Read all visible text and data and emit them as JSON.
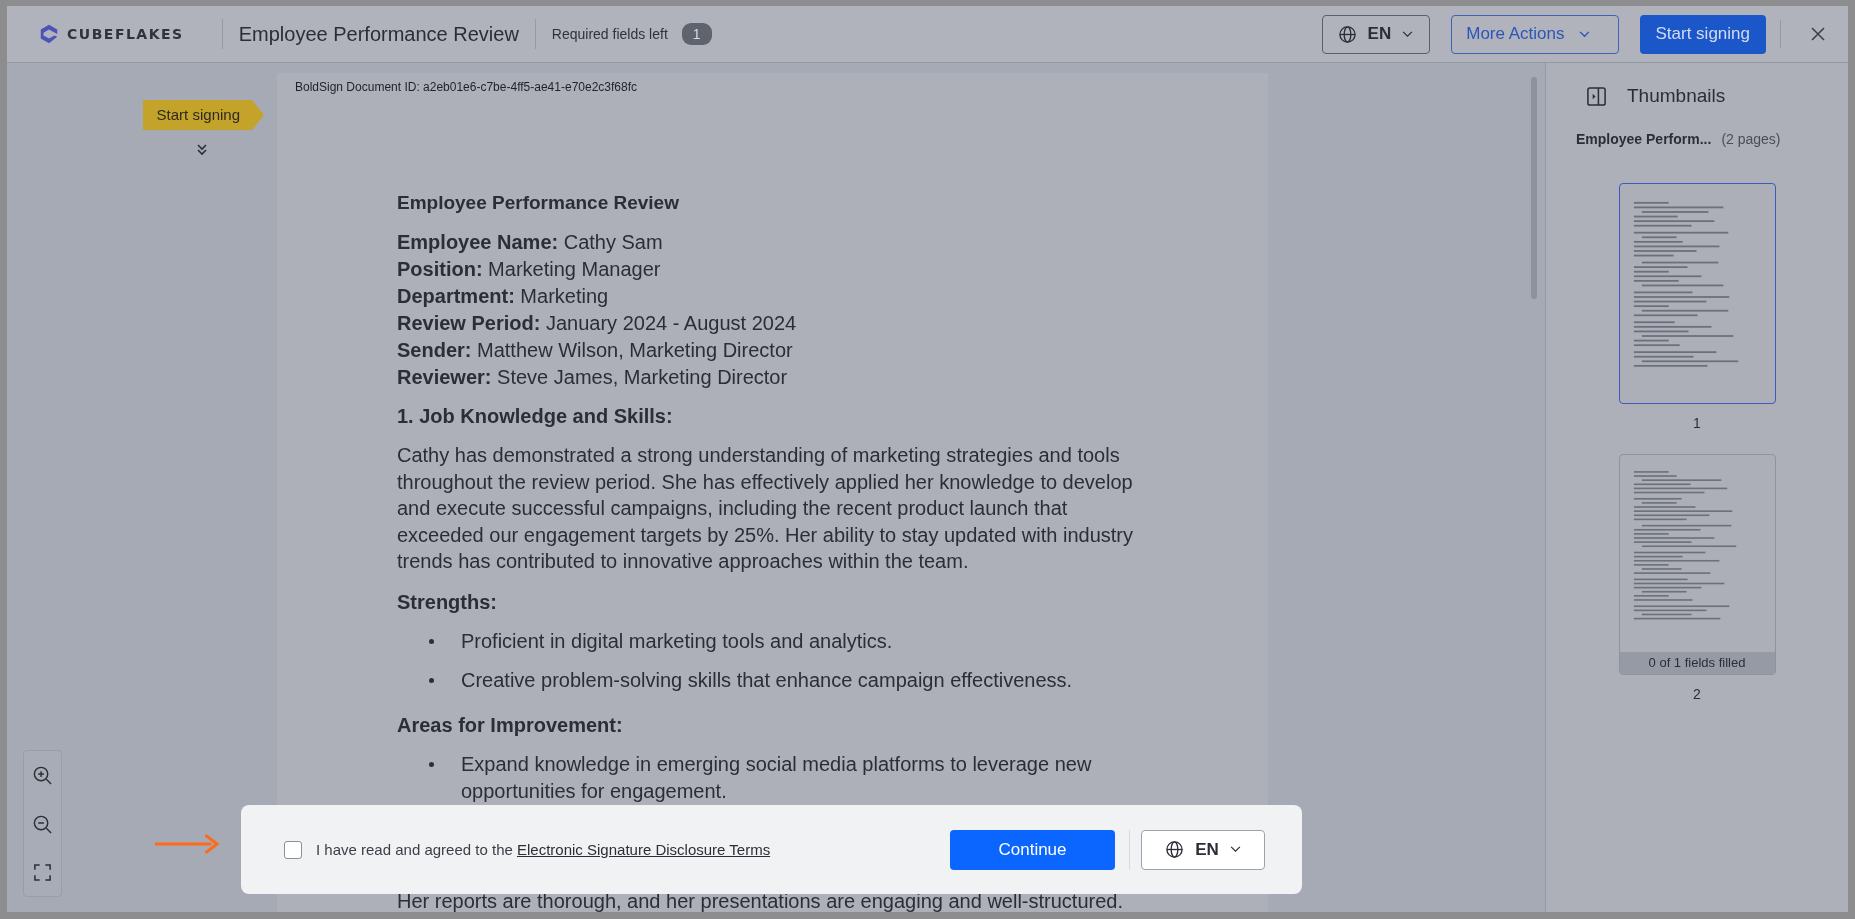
{
  "header": {
    "logo_text": "CUBEFLAKES",
    "title": "Employee Performance Review",
    "required_label": "Required fields left",
    "required_count": "1",
    "language": "EN",
    "more_actions": "More Actions",
    "start_signing": "Start signing"
  },
  "guide": {
    "tag": "Start signing"
  },
  "document": {
    "id_line": "BoldSign Document ID: a2eb01e6-c7be-4ff5-ae41-e70e2c3f68fc",
    "blocks": [
      {
        "kind": "title",
        "text": "Employee Performance Review"
      },
      {
        "kind": "fields",
        "lines": [
          "**Employee Name:** Cathy Sam",
          "**Position:** Marketing Manager",
          "**Department:** Marketing",
          "**Review Period:** January 2024 - August 2024",
          "**Sender:** Matthew Wilson, Marketing Director",
          "**Reviewer:** Steve James, Marketing Director"
        ]
      },
      {
        "kind": "heading",
        "text": "1. Job Knowledge and Skills:"
      },
      {
        "kind": "paragraph",
        "text": "Cathy has demonstrated a strong understanding of marketing strategies and tools throughout the review period. She has effectively applied her knowledge to develop and execute successful campaigns, including the recent product launch that exceeded our engagement targets by 25%. Her ability to stay updated with industry trends has contributed to innovative approaches within the team."
      },
      {
        "kind": "heading",
        "text": "Strengths:"
      },
      {
        "kind": "bullets",
        "items": [
          "Proficient in digital marketing tools and analytics.",
          "Creative problem-solving skills that enhance campaign effectiveness."
        ]
      },
      {
        "kind": "heading",
        "text": "Areas for Improvement:"
      },
      {
        "kind": "bullets",
        "items": [
          "Expand knowledge in emerging social media platforms to leverage new opportunities for engagement."
        ]
      },
      {
        "kind": "tail",
        "text": "Her reports are thorough, and her presentations are engaging and well-structured."
      }
    ]
  },
  "thumbnails": {
    "title": "Thumbnails",
    "doc_name": "Employee Perform...",
    "page_count": "(2 pages)",
    "pages": [
      {
        "number": "1",
        "selected": true
      },
      {
        "number": "2",
        "selected": false,
        "status": "0 of 1 fields filled"
      }
    ]
  },
  "consent": {
    "checked": false,
    "text": "I have read and agreed to the ",
    "link": "Electronic Signature Disclosure Terms",
    "continue": "Continue",
    "language": "EN"
  }
}
